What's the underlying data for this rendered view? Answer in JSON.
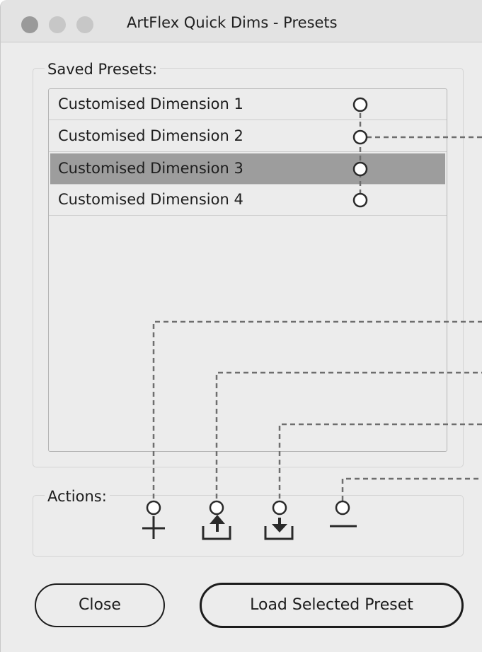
{
  "window": {
    "title": "ArtFlex Quick Dims - Presets"
  },
  "saved_presets": {
    "label": "Saved Presets:",
    "items": [
      {
        "label": "Customised Dimension 1",
        "selected": false
      },
      {
        "label": "Customised Dimension 2",
        "selected": false
      },
      {
        "label": "Customised Dimension 3",
        "selected": true
      },
      {
        "label": "Customised Dimension 4",
        "selected": false
      }
    ]
  },
  "actions": {
    "label": "Actions:",
    "icons": [
      "add-icon",
      "export-icon",
      "import-icon",
      "remove-icon"
    ]
  },
  "buttons": {
    "close_label": "Close",
    "load_label": "Load Selected Preset"
  },
  "colors": {
    "window_bg": "#ececec",
    "selected_row": "#9d9d9d",
    "callout_line": "#6e6e6e"
  }
}
